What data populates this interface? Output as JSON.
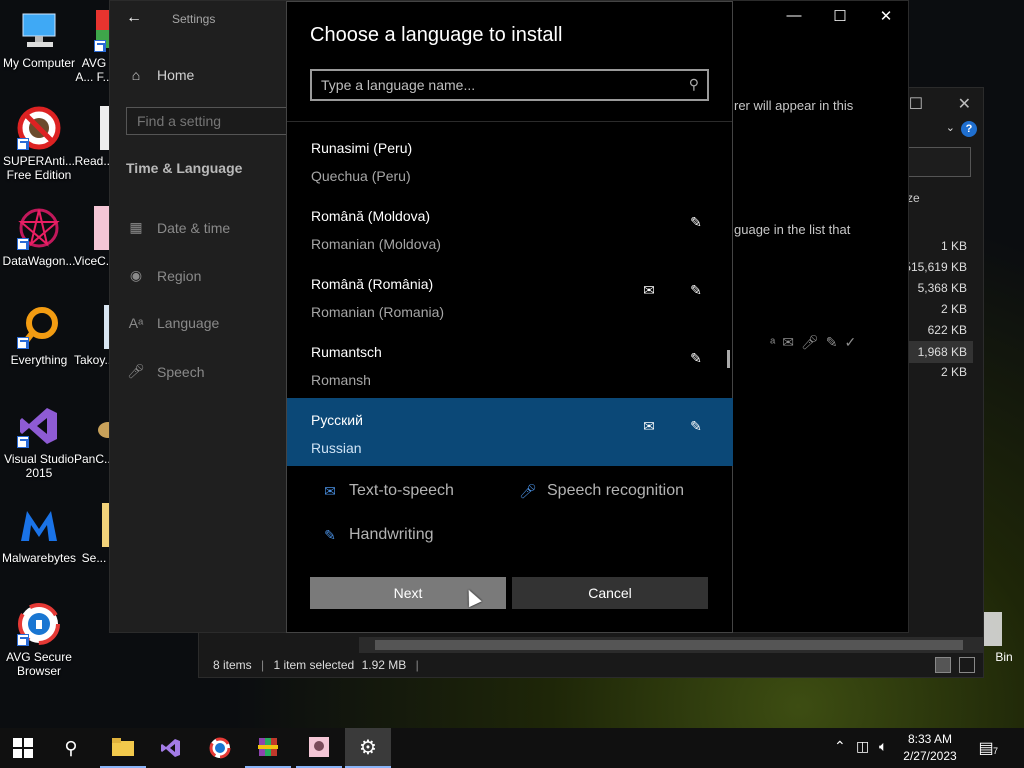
{
  "desktop": {
    "icons": [
      {
        "label": "My Computer",
        "icon": "computer-icon"
      },
      {
        "label": "AVG A... F...",
        "icon": "avg-icon"
      },
      {
        "label": "SUPERAnti... Free Edition",
        "icon": "superantispyware-icon"
      },
      {
        "label": "Read...",
        "icon": "document-icon"
      },
      {
        "label": "DataWagon...",
        "icon": "datawagon-icon"
      },
      {
        "label": "ViceC...",
        "icon": "vicec-icon"
      },
      {
        "label": "Everything",
        "icon": "everything-icon"
      },
      {
        "label": "Takoy...",
        "icon": "takoy-icon"
      },
      {
        "label": "Visual Studio 2015",
        "icon": "visual-studio-icon"
      },
      {
        "label": "PanC...",
        "icon": "panc-icon"
      },
      {
        "label": "Malwarebytes",
        "icon": "malwarebytes-icon"
      },
      {
        "label": "Se...",
        "icon": "folder-icon"
      },
      {
        "label": "AVG Secure Browser",
        "icon": "avg-browser-icon"
      }
    ],
    "recycle_bin_label": "Bin"
  },
  "explorer": {
    "column_header": "ze",
    "sizes": [
      "1 KB",
      "515,619 KB",
      "5,368 KB",
      "2 KB",
      "622 KB",
      "1,968 KB",
      "2 KB"
    ],
    "status": {
      "items": "8 items",
      "selected": "1 item selected",
      "size": "1.92 MB"
    }
  },
  "settings": {
    "title": "Settings",
    "home": "Home",
    "search_placeholder": "Find a setting",
    "section": "Time & Language",
    "nav": [
      {
        "label": "Date & time",
        "icon": "calendar-icon"
      },
      {
        "label": "Region",
        "icon": "globe-icon"
      },
      {
        "label": "Language",
        "icon": "language-icon"
      },
      {
        "label": "Speech",
        "icon": "microphone-icon"
      }
    ],
    "right_text_1": "rer will appear in this",
    "right_text_2": "guage in the list that"
  },
  "dialog": {
    "title": "Choose a language to install",
    "search_placeholder": "Type a language name...",
    "languages": [
      {
        "native": "Runasimi (Peru)",
        "english": "Quechua (Peru)",
        "tts": false,
        "handwriting": false,
        "selected": false
      },
      {
        "native": "Română (Moldova)",
        "english": "Romanian (Moldova)",
        "tts": false,
        "handwriting": true,
        "selected": false
      },
      {
        "native": "Română (România)",
        "english": "Romanian (Romania)",
        "tts": true,
        "handwriting": true,
        "selected": false
      },
      {
        "native": "Rumantsch",
        "english": "Romansh",
        "tts": false,
        "handwriting": true,
        "selected": false
      },
      {
        "native": "Русский",
        "english": "Russian",
        "tts": true,
        "handwriting": true,
        "selected": true
      }
    ],
    "features": {
      "tts": "Text-to-speech",
      "speech": "Speech recognition",
      "handwriting": "Handwriting"
    },
    "next_label": "Next",
    "cancel_label": "Cancel"
  },
  "taskbar": {
    "time": "8:33 AM",
    "date": "2/27/2023",
    "notification_count": "7"
  }
}
